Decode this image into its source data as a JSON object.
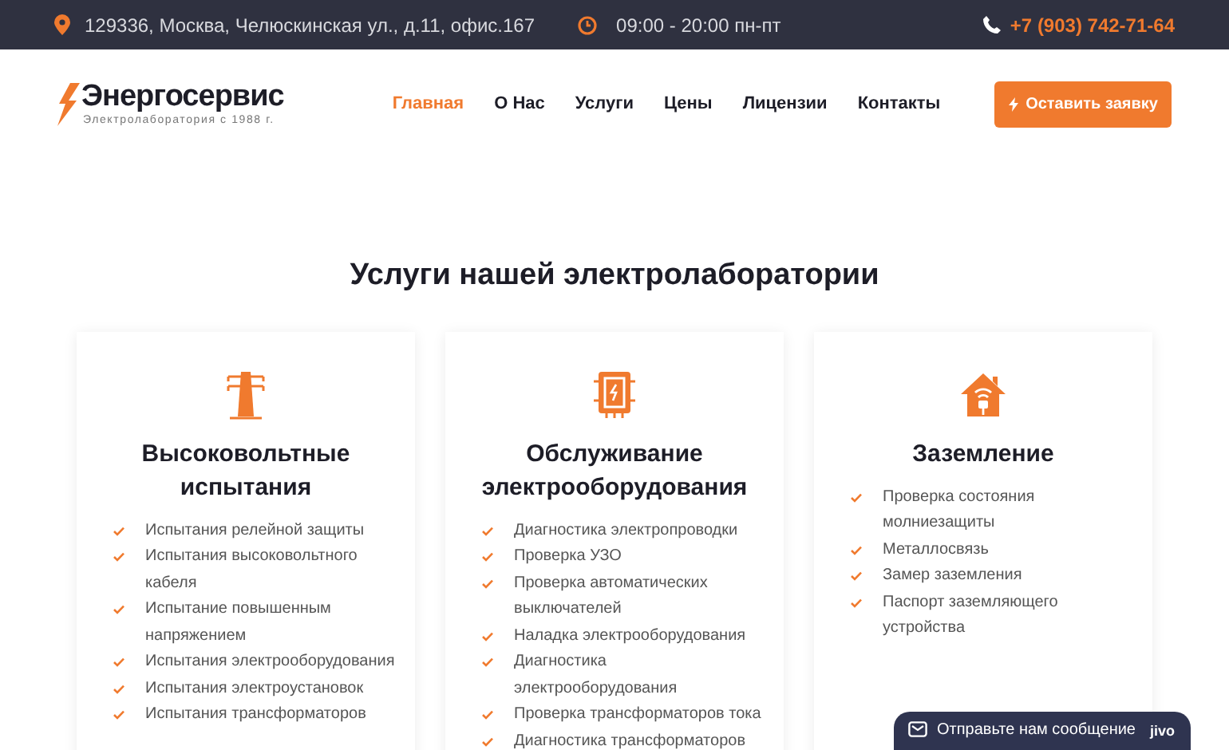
{
  "top_bar": {
    "address": "129336, Москва, Челюскинская ул., д.11, офис.167",
    "hours": "09:00 - 20:00 пн-пт",
    "phone": "+7 (903) 742-71-64"
  },
  "header": {
    "logo_title": "Энергосервис",
    "logo_subtitle": "Электролаборатория с 1988 г.",
    "nav": [
      {
        "label": "Главная",
        "selected": true
      },
      {
        "label": "О Нас",
        "selected": false
      },
      {
        "label": "Услуги",
        "selected": false
      },
      {
        "label": "Цены",
        "selected": false
      },
      {
        "label": "Лицензии",
        "selected": false
      },
      {
        "label": "Контакты",
        "selected": false
      }
    ],
    "cta_button": "Оставить заявку"
  },
  "section_title": "Услуги нашей электролаборатории",
  "cards": [
    {
      "kind": "tower",
      "title": "Высоковольтные испытания",
      "items": [
        "Испытания релейной защиты",
        "Испытания высоковольтного кабеля",
        "Испытание повышенным напряжением",
        "Испытания электрооборудования",
        "Испытания электроустановок",
        "Испытания трансформаторов"
      ]
    },
    {
      "kind": "panel",
      "title": "Обслуживание электрооборудования",
      "items": [
        "Диагностика электропроводки",
        "Проверка УЗО",
        "Проверка автоматических выключателей",
        "Наладка электрооборудования",
        "Диагностика электрооборудования",
        "Проверка трансформаторов тока",
        "Диагностика трансформаторов"
      ]
    },
    {
      "kind": "house",
      "title": "Заземление",
      "items": [
        "Проверка состояния молниезащиты",
        "Металлосвязь",
        "Замер заземления",
        "Паспорт заземляющего устройства"
      ]
    }
  ],
  "chat_widget": {
    "label": "Отправьте нам сообщение",
    "brand": "jivo"
  }
}
